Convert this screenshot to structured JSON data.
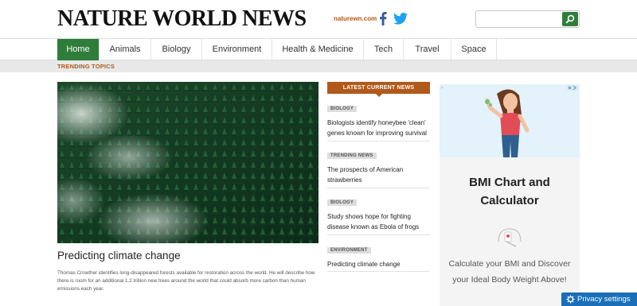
{
  "header": {
    "logo": "NATURE WORLD NEWS",
    "site_link": "naturewn.com",
    "social_icons": [
      "facebook-icon",
      "twitter-icon"
    ],
    "search": {
      "placeholder": "",
      "button_icon": "search-icon"
    }
  },
  "nav": {
    "items": [
      {
        "label": "Home",
        "active": true
      },
      {
        "label": "Animals",
        "active": false
      },
      {
        "label": "Biology",
        "active": false
      },
      {
        "label": "Environment",
        "active": false
      },
      {
        "label": "Health & Medicine",
        "active": false
      },
      {
        "label": "Tech",
        "active": false
      },
      {
        "label": "Travel",
        "active": false
      },
      {
        "label": "Space",
        "active": false
      }
    ]
  },
  "trending": {
    "label": "TRENDING TOPICS"
  },
  "hero": {
    "title": "Predicting climate change",
    "description": "Thomas Crowther identifies long-disappeared forests available for restoration across the world. He will describe how there is room for an additional 1.2 trillion new trees around the world that could absorb more carbon than human emissions each year."
  },
  "latest": {
    "heading": "LATEST CURRENT NEWS",
    "items": [
      {
        "tag": "BIOLOGY",
        "title": "Biologists identify honeybee 'clean' genes known for improving survival"
      },
      {
        "tag": "TRENDING NEWS",
        "title": "The prospects of American strawberries"
      },
      {
        "tag": "BIOLOGY",
        "title": "Study shows hope for fighting disease known as Ebola of frogs"
      },
      {
        "tag": "ENVIRONMENT",
        "title": "Predicting climate change"
      }
    ]
  },
  "ad": {
    "title": "BMI Chart and Calculator",
    "description": "Calculate your BMI and Discover your Ideal Body Weight Above!"
  },
  "privacy": {
    "label": "Privacy settings"
  },
  "colors": {
    "accent_green": "#2f7d3b",
    "accent_orange": "#b1591b",
    "privacy_blue": "#1a6fb8"
  }
}
